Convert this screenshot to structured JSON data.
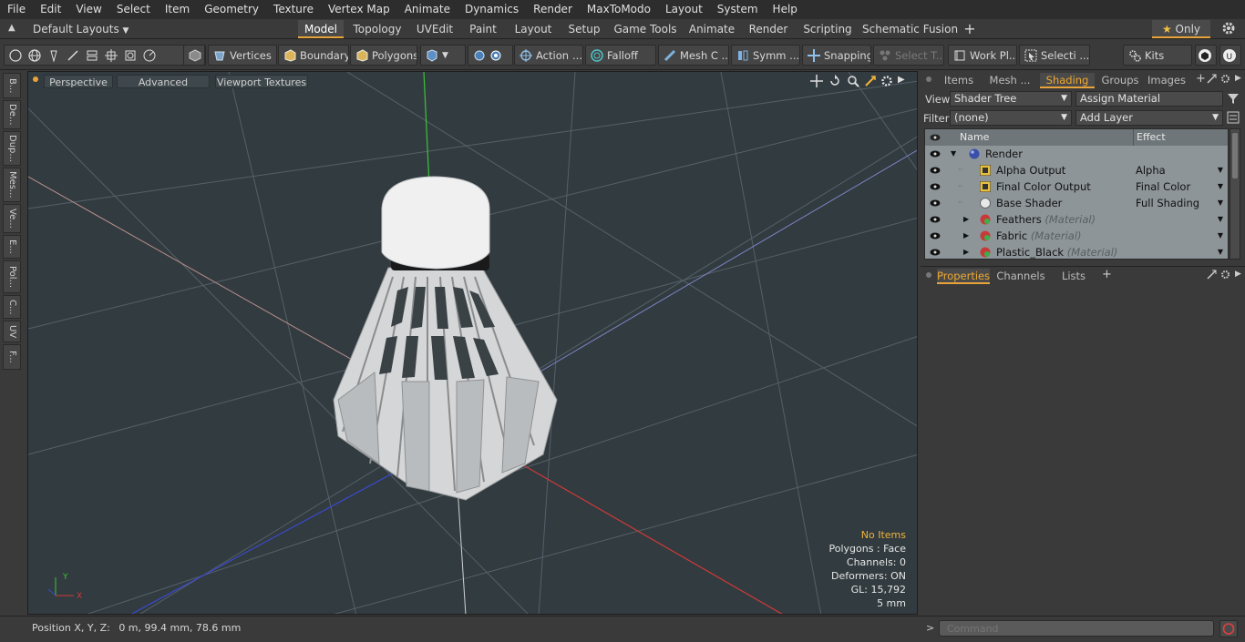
{
  "menu": [
    "File",
    "Edit",
    "View",
    "Select",
    "Item",
    "Geometry",
    "Texture",
    "Vertex Map",
    "Animate",
    "Dynamics",
    "Render",
    "MaxToModo",
    "Layout",
    "System",
    "Help"
  ],
  "layouts": {
    "selector": "Default Layouts",
    "tabs": [
      "Model",
      "Topology",
      "UVEdit",
      "Paint",
      "Layout",
      "Setup",
      "Game Tools",
      "Animate",
      "Render",
      "Scripting",
      "Schematic Fusion"
    ],
    "active_tab": "Model",
    "add": "+",
    "only_label": "Only",
    "star": "★"
  },
  "toolbar": {
    "vertices": "Vertices",
    "boundary": "Boundary",
    "polygons": "Polygons",
    "action": "Action",
    "falloff": "Falloff",
    "mesh": "Mesh C ...",
    "symmetry": "Symm ...",
    "snapping": "Snapping",
    "select_t": "Select T...",
    "work_plane": "Work Pl...",
    "selection": "Selecti ...",
    "kits": "Kits",
    "more": "..."
  },
  "left_tabs": [
    "B...",
    "De...",
    "Dup...",
    "Mes...",
    "Ve...",
    "E...",
    "Pol...",
    "C...",
    "UV",
    "F..."
  ],
  "viewport": {
    "view_mode": "Perspective",
    "advanced": "Advanced",
    "textures": "Viewport Textures",
    "info": {
      "items": "No Items",
      "polygons": "Polygons : Face",
      "channels": "Channels: 0",
      "deformers": "Deformers: ON",
      "gl": "GL: 15,792",
      "scale": "5 mm"
    }
  },
  "status": {
    "position_label": "Position X, Y, Z:",
    "position_value": "0 m, 99.4 mm, 78.6 mm"
  },
  "right_panel": {
    "tabs": [
      "Items",
      "Mesh ...",
      "Shading",
      "Groups",
      "Images"
    ],
    "active_tab": "Shading",
    "view_label": "View",
    "view_value": "Shader Tree",
    "assign_material": "Assign Material",
    "filter_label": "Filter",
    "filter_value": "(none)",
    "add_layer": "Add Layer",
    "columns": {
      "name": "Name",
      "effect": "Effect"
    },
    "rows": [
      {
        "name": "Render",
        "tag": "",
        "effect": ""
      },
      {
        "name": "Alpha Output",
        "tag": "",
        "effect": "Alpha"
      },
      {
        "name": "Final Color Output",
        "tag": "",
        "effect": "Final Color"
      },
      {
        "name": "Base Shader",
        "tag": "",
        "effect": "Full Shading"
      },
      {
        "name": "Feathers",
        "tag": "(Material)",
        "effect": ""
      },
      {
        "name": "Fabric",
        "tag": "(Material)",
        "effect": ""
      },
      {
        "name": "Plastic_Black",
        "tag": "(Material)",
        "effect": ""
      }
    ],
    "bottom_tabs": [
      "Properties",
      "Channels",
      "Lists"
    ],
    "bottom_active": "Properties",
    "bottom_add": "+"
  },
  "command": {
    "placeholder": "Command"
  },
  "colors": {
    "accent": "#e8a33a",
    "viewport_bg": "#323b3f",
    "panel": "#3a3a3a"
  }
}
